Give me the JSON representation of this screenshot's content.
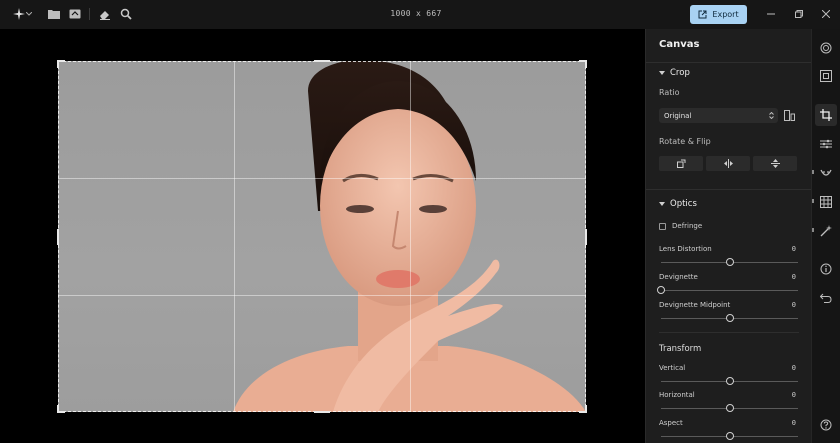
{
  "topbar": {
    "dimensions": "1000 x 667",
    "export_label": "Export"
  },
  "panel": {
    "title": "Canvas",
    "crop": {
      "title": "Crop",
      "ratio_label": "Ratio",
      "ratio_value": "Original",
      "rotate_flip_label": "Rotate & Flip"
    },
    "optics": {
      "title": "Optics",
      "defringe_label": "Defringe",
      "defringe_checked": false,
      "sliders": [
        {
          "label": "Lens Distortion",
          "value": "0",
          "position": 0.5
        },
        {
          "label": "Devignette",
          "value": "0",
          "position": 0.0
        },
        {
          "label": "Devignette Midpoint",
          "value": "0",
          "position": 0.5
        }
      ]
    },
    "transform": {
      "title": "Transform",
      "sliders": [
        {
          "label": "Vertical",
          "value": "0",
          "position": 0.5
        },
        {
          "label": "Horizontal",
          "value": "0",
          "position": 0.5
        },
        {
          "label": "Aspect",
          "value": "0",
          "position": 0.5
        }
      ]
    }
  },
  "colors": {
    "accent": "#a8d2f3",
    "panel_bg": "#1e1e1e",
    "canvas_bg": "#000000"
  }
}
